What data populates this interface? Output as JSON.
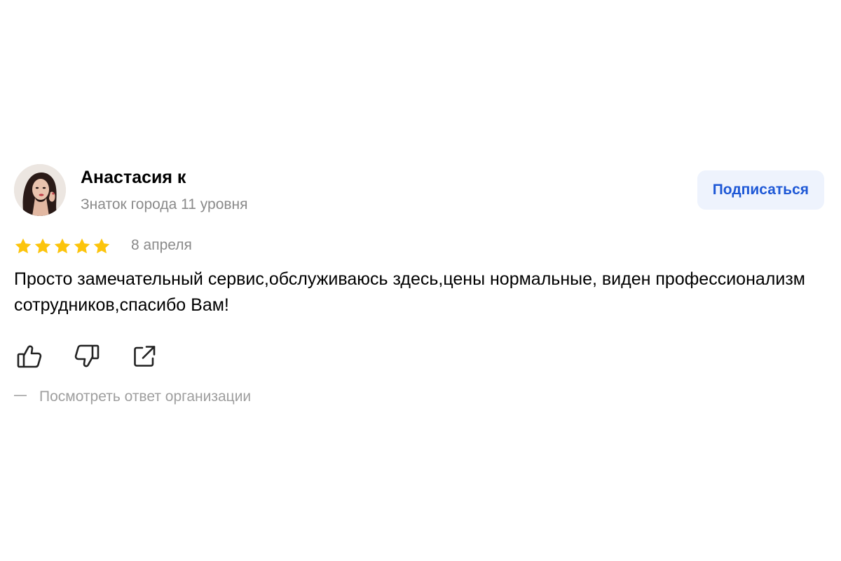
{
  "review": {
    "author": {
      "name": "Анастасия к",
      "level": "Знаток города 11 уровня",
      "avatar_icon": "user-photo"
    },
    "subscribe_label": "Подписаться",
    "rating": {
      "value": 5,
      "max": 5,
      "star_color": "#fcc40b"
    },
    "date": "8 апреля",
    "text": "Просто замечательный сервис,обслуживаюсь здесь,цены нормальные, виден профессионализм сотрудников,спасибо Вам!",
    "actions": {
      "like_icon": "thumbs-up-icon",
      "dislike_icon": "thumbs-down-icon",
      "share_icon": "share-icon"
    },
    "org_reply_label": "Посмотреть ответ организации"
  },
  "colors": {
    "accent": "#1e58d6",
    "button_bg": "#eef3fd",
    "muted_text": "#8a8a8a"
  }
}
